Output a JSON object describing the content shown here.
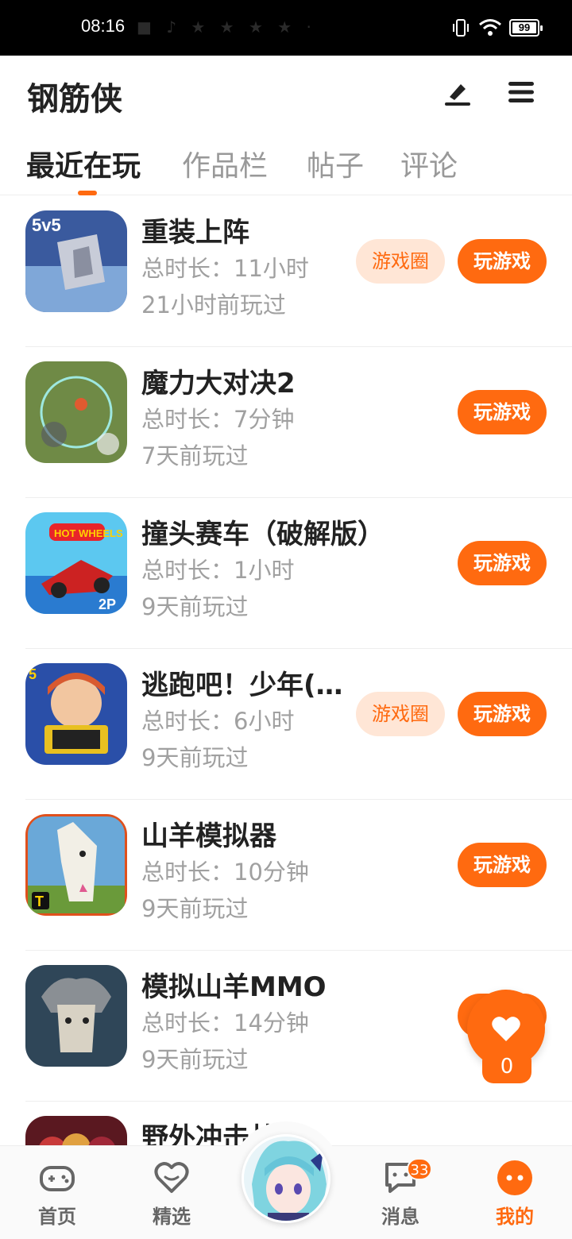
{
  "status_bar": {
    "time": "08:16",
    "battery": "99"
  },
  "header": {
    "title": "钢筋侠"
  },
  "tabs": [
    {
      "label": "最近在玩"
    },
    {
      "label": "作品栏"
    },
    {
      "label": "帖子"
    },
    {
      "label": "评论"
    }
  ],
  "games": [
    {
      "name": "重装上阵",
      "duration": "总时长：11小时",
      "last_played": "21小时前玩过",
      "circle_label": "游戏圈",
      "play_label": "玩游戏"
    },
    {
      "name": "魔力大对决2",
      "duration": "总时长：7分钟",
      "last_played": "7天前玩过",
      "play_label": "玩游戏"
    },
    {
      "name": "撞头赛车（破解版）",
      "duration": "总时长：1小时",
      "last_played": "9天前玩过",
      "play_label": "玩游戏"
    },
    {
      "name": "逃跑吧！少年(…",
      "duration": "总时长：6小时",
      "last_played": "9天前玩过",
      "circle_label": "游戏圈",
      "play_label": "玩游戏"
    },
    {
      "name": "山羊模拟器",
      "duration": "总时长：10分钟",
      "last_played": "9天前玩过",
      "play_label": "玩游戏"
    },
    {
      "name": "模拟山羊MMO",
      "duration": "总时长：14分钟",
      "last_played": "9天前玩过",
      "play_label": "玩游戏"
    },
    {
      "name": "野外冲击战"
    }
  ],
  "like": {
    "count": "0"
  },
  "bottom_nav": {
    "home": "首页",
    "featured": "精选",
    "messages": "消息",
    "messages_badge": "33",
    "mine": "我的"
  },
  "colors": {
    "accent": "#ff6a10",
    "accent_light": "#ffe6d6"
  }
}
